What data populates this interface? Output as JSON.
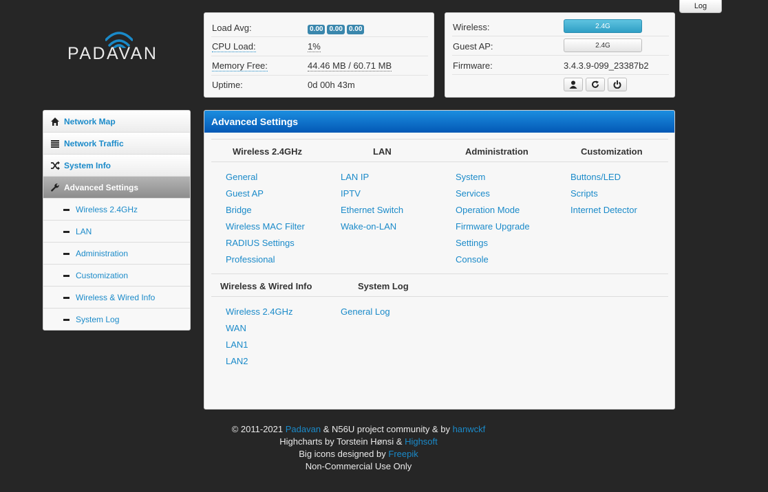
{
  "logo": {
    "text": "PADAVAN"
  },
  "log_button": "Log",
  "status_left": {
    "load_avg": {
      "label": "Load Avg:",
      "values": [
        "0.00",
        "0.00",
        "0.00"
      ]
    },
    "cpu_load": {
      "label": "CPU Load:",
      "value": "1%"
    },
    "memory_free": {
      "label": "Memory Free:",
      "value": "44.46 MB / 60.71 MB"
    },
    "uptime": {
      "label": "Uptime:",
      "value": "0d 00h 43m"
    }
  },
  "status_right": {
    "wireless": {
      "label": "Wireless:",
      "value": "2.4G"
    },
    "guest_ap": {
      "label": "Guest AP:",
      "value": "2.4G"
    },
    "firmware": {
      "label": "Firmware:",
      "value": "3.4.3.9-099_23387b2"
    }
  },
  "sidebar": {
    "items": [
      {
        "label": "Network Map"
      },
      {
        "label": "Network Traffic"
      },
      {
        "label": "System Info"
      },
      {
        "label": "Advanced Settings"
      }
    ],
    "sub_items": [
      {
        "label": "Wireless 2.4GHz"
      },
      {
        "label": "LAN"
      },
      {
        "label": "Administration"
      },
      {
        "label": "Customization"
      },
      {
        "label": "Wireless & Wired Info"
      },
      {
        "label": "System Log"
      }
    ]
  },
  "main": {
    "title": "Advanced Settings",
    "section1": {
      "wireless": {
        "title": "Wireless 2.4GHz",
        "links": [
          "General",
          "Guest AP",
          "Bridge",
          "Wireless MAC Filter",
          "RADIUS Settings",
          "Professional"
        ]
      },
      "lan": {
        "title": "LAN",
        "links": [
          "LAN IP",
          "IPTV",
          "Ethernet Switch",
          "Wake-on-LAN"
        ]
      },
      "admin": {
        "title": "Administration",
        "links": [
          "System",
          "Services",
          "Operation Mode",
          "Firmware Upgrade",
          "Settings",
          "Console"
        ]
      },
      "custom": {
        "title": "Customization",
        "links": [
          "Buttons/LED",
          "Scripts",
          "Internet Detector"
        ]
      }
    },
    "section2": {
      "info": {
        "title": "Wireless & Wired Info",
        "links": [
          "Wireless 2.4GHz",
          "WAN",
          "LAN1",
          "LAN2"
        ]
      },
      "syslog": {
        "title": "System Log",
        "links": [
          "General Log"
        ]
      }
    }
  },
  "footer": {
    "line1_prefix": "© 2011-2021",
    "line1_link1": "Padavan",
    "line1_mid": "& N56U project community & by",
    "line1_link2": "hanwckf",
    "line2_prefix": "Highcharts by Torstein Hønsi &",
    "line2_link": "Highsoft",
    "line3_prefix": "Big icons designed by",
    "line3_link": "Freepik",
    "line4": "Non-Commercial Use Only"
  }
}
